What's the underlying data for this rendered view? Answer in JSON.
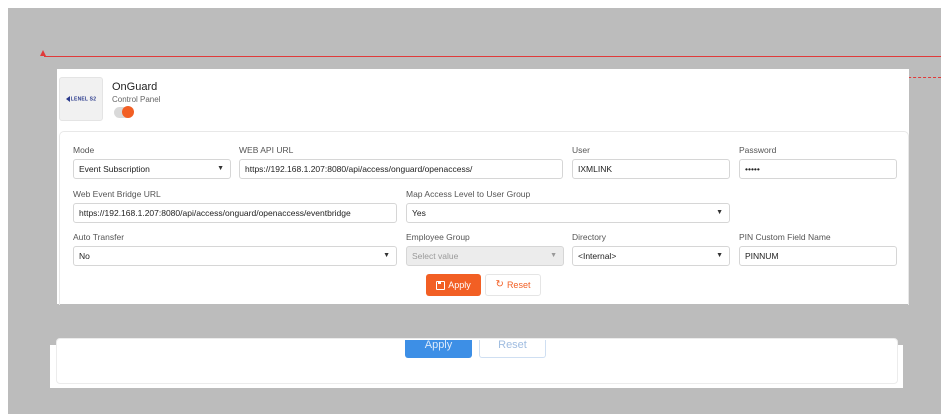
{
  "header": {
    "logo_text": "LENEL S2",
    "title": "OnGuard",
    "subtitle": "Control Panel"
  },
  "form": {
    "mode": {
      "label": "Mode",
      "value": "Event Subscription"
    },
    "web_api_url": {
      "label": "WEB API URL",
      "value": "https://192.168.1.207:8080/api/access/onguard/openaccess/"
    },
    "user": {
      "label": "User",
      "value": "IXMLINK"
    },
    "password": {
      "label": "Password",
      "value": "•••••"
    },
    "web_event_bridge_url": {
      "label": "Web Event Bridge URL",
      "value": "https://192.168.1.207:8080/api/access/onguard/openaccess/eventbridge"
    },
    "map_access_level": {
      "label": "Map Access Level to User Group",
      "value": "Yes"
    },
    "auto_transfer": {
      "label": "Auto Transfer",
      "value": "No"
    },
    "employee_group": {
      "label": "Employee Group",
      "placeholder": "Select value"
    },
    "directory": {
      "label": "Directory",
      "value": "<Internal>"
    },
    "pin_custom_field": {
      "label": "PIN Custom Field Name",
      "value": "PINNUM"
    }
  },
  "actions": {
    "apply_label": "Apply",
    "reset_label": "Reset"
  },
  "background_panel": {
    "apply_label": "Apply",
    "reset_label": "Reset"
  },
  "colors": {
    "accent": "#f25f24",
    "ghost_blue": "#3d8fe6",
    "annotation_red": "#e03a3a"
  }
}
